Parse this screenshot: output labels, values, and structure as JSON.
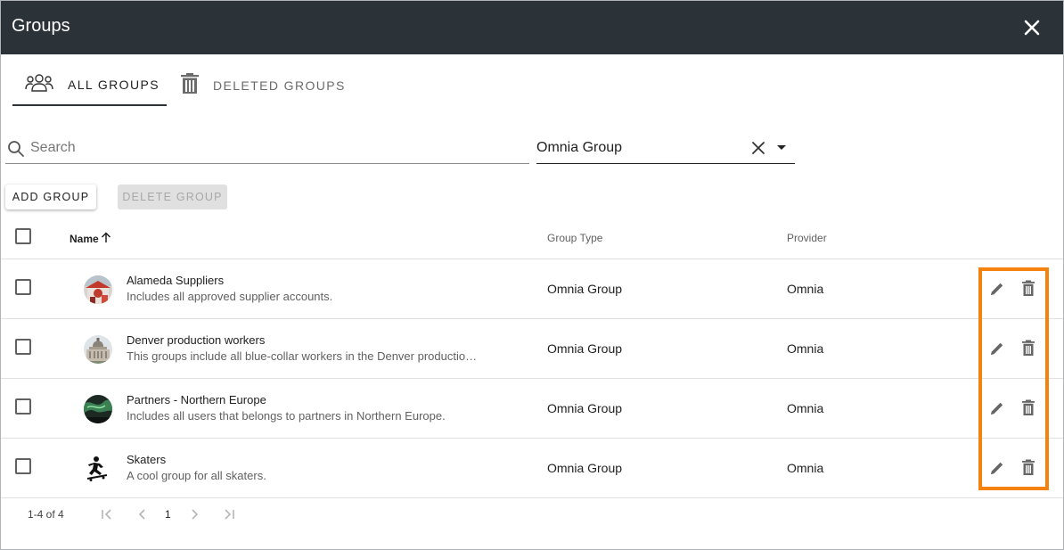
{
  "dialog": {
    "title": "Groups",
    "close_icon": "close-icon"
  },
  "tabs": [
    {
      "label": "ALL GROUPS",
      "icon": "people-icon",
      "active": true
    },
    {
      "label": "DELETED GROUPS",
      "icon": "trash-icon",
      "active": false
    }
  ],
  "search": {
    "placeholder": "Search",
    "value": ""
  },
  "filter": {
    "value": "Omnia Group"
  },
  "toolbar": {
    "add_label": "ADD GROUP",
    "delete_label": "DELETE GROUP"
  },
  "table": {
    "columns": {
      "name": "Name",
      "type": "Group Type",
      "provider": "Provider"
    },
    "sort": {
      "column": "Name",
      "direction": "ascending"
    },
    "rows": [
      {
        "name": "Alameda Suppliers",
        "description": "Includes all approved supplier accounts.",
        "type": "Omnia Group",
        "provider": "Omnia",
        "avatar": "market-stall-photo"
      },
      {
        "name": "Denver production workers",
        "description": "This groups include all blue-collar workers in the Denver productio…",
        "type": "Omnia Group",
        "provider": "Omnia",
        "avatar": "capitol-building-photo"
      },
      {
        "name": "Partners - Northern Europe",
        "description": "Includes all users that belongs to partners in Northern Europe.",
        "type": "Omnia Group",
        "provider": "Omnia",
        "avatar": "aurora-photo"
      },
      {
        "name": "Skaters",
        "description": "A cool group for all skaters.",
        "type": "Omnia Group",
        "provider": "Omnia",
        "avatar": "skater-silhouette"
      }
    ]
  },
  "pagination": {
    "range": "1-4 of 4",
    "page": "1"
  },
  "colors": {
    "titlebar": "#2b3238",
    "highlight": "#f5820f"
  }
}
